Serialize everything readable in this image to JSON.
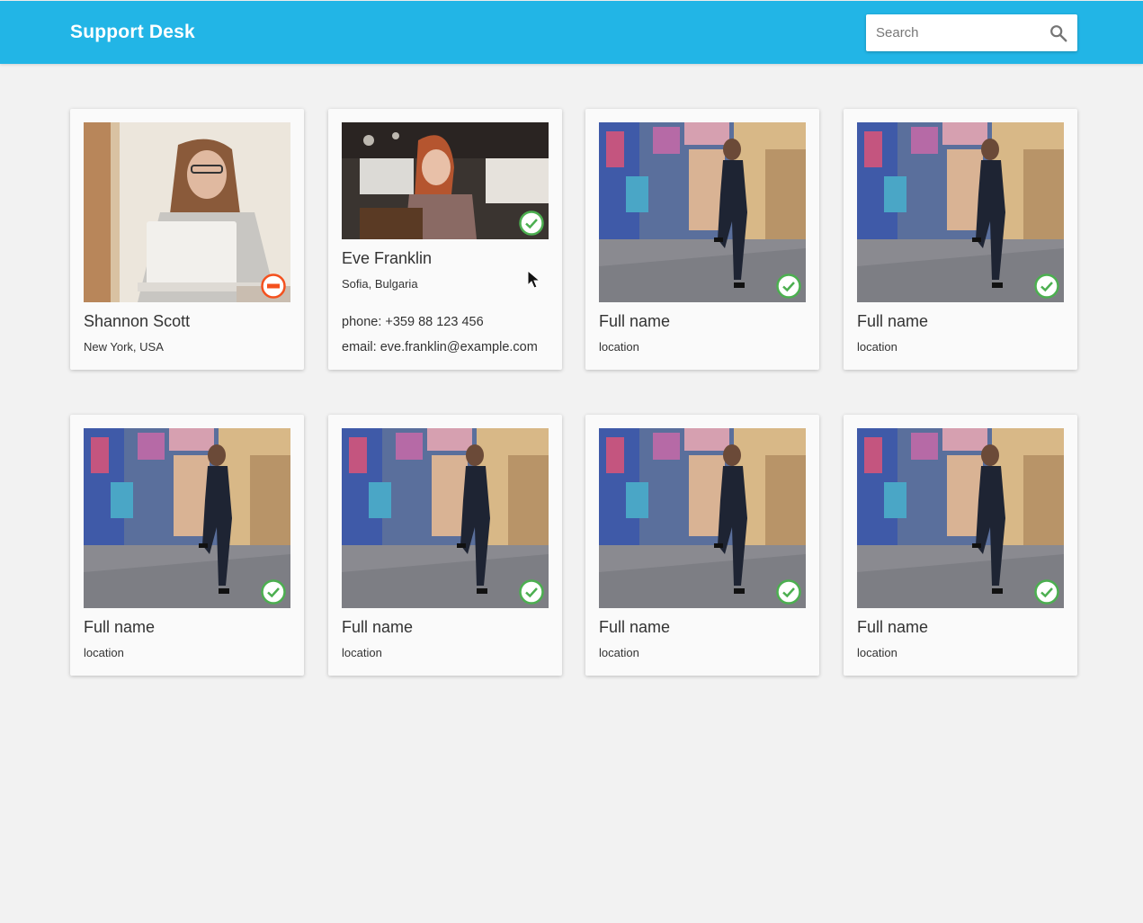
{
  "app": {
    "title": "Support Desk"
  },
  "search": {
    "placeholder": "Search",
    "value": "",
    "icon": "search-icon"
  },
  "status_colors": {
    "online": "#4caf50",
    "busy": "#f4511e"
  },
  "cards": [
    {
      "name": "Shannon Scott",
      "location": "New York, USA",
      "status": "busy",
      "photo": "woman-with-laptop"
    },
    {
      "name": "Eve Franklin",
      "location": "Sofia, Bulgaria",
      "status": "online",
      "photo": "woman-in-cafe",
      "phone": "phone: +359 88 123 456",
      "email": "email: eve.franklin@example.com",
      "expanded": true
    },
    {
      "name": "Full name",
      "location": "location",
      "status": "online",
      "photo": "man-leaning-on-wall"
    },
    {
      "name": "Full name",
      "location": "location",
      "status": "online",
      "photo": "man-leaning-on-wall"
    },
    {
      "name": "Full name",
      "location": "location",
      "status": "online",
      "photo": "man-leaning-on-wall"
    },
    {
      "name": "Full name",
      "location": "location",
      "status": "online",
      "photo": "man-leaning-on-wall"
    },
    {
      "name": "Full name",
      "location": "location",
      "status": "online",
      "photo": "man-leaning-on-wall"
    },
    {
      "name": "Full name",
      "location": "location",
      "status": "online",
      "photo": "man-leaning-on-wall"
    }
  ]
}
